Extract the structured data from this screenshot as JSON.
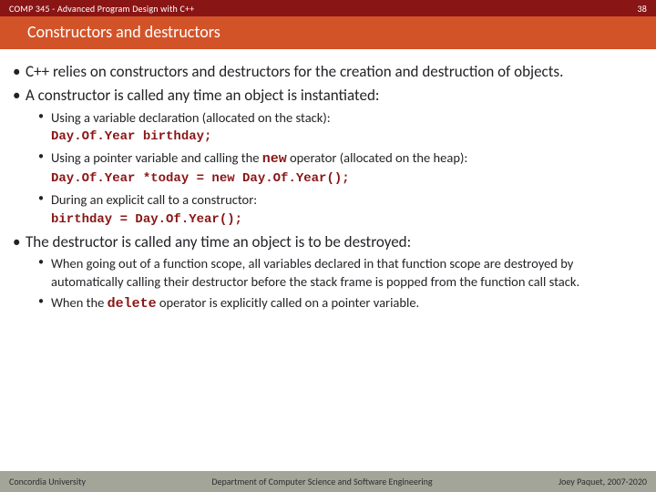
{
  "header": {
    "course": "COMP 345 - Advanced Program Design with C++",
    "slideNumber": "38"
  },
  "title": "Constructors and destructors",
  "bullets": [
    {
      "text": "C++ relies on constructors and destructors for the creation and destruction of objects."
    },
    {
      "text": "A constructor is called any time an object is instantiated:",
      "sub": [
        {
          "text": "Using a variable declaration (allocated on the stack):",
          "code": "Day.Of.Year birthday;"
        },
        {
          "text_pre": "Using a pointer variable and calling the ",
          "kw": "new",
          "text_post": "  operator (allocated on the heap):",
          "code": "Day.Of.Year *today = new Day.Of.Year();"
        },
        {
          "text": "During an explicit call to a constructor:",
          "code": "birthday = Day.Of.Year();"
        }
      ]
    },
    {
      "text": "The destructor is called any time an object is to be destroyed:",
      "sub": [
        {
          "text": "When going out of a function scope, all variables declared in that function scope are destroyed by automatically calling their destructor before the stack frame is popped from the function call stack."
        },
        {
          "text_pre": "When the ",
          "kw": "delete",
          "text_post": " operator is explicitly called on a pointer variable."
        }
      ]
    }
  ],
  "footer": {
    "left": "Concordia University",
    "center": "Department of Computer Science and Software Engineering",
    "right": "Joey Paquet, 2007-2020"
  }
}
